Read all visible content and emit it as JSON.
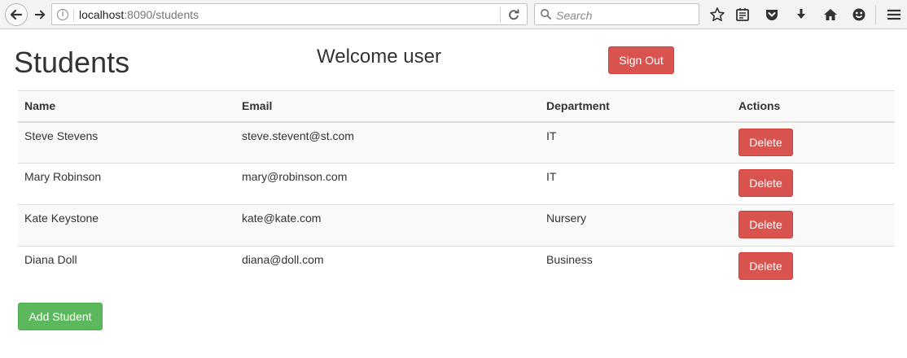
{
  "browser": {
    "url_host": "localhost",
    "url_rest": ":8090/students",
    "search_placeholder": "Search"
  },
  "header": {
    "title": "Students",
    "welcome": "Welcome user",
    "signout_label": "Sign Out"
  },
  "table": {
    "columns": [
      "Name",
      "Email",
      "Department",
      "Actions"
    ],
    "rows": [
      {
        "name": "Steve Stevens",
        "email": "steve.stevent@st.com",
        "department": "IT",
        "action": "Delete"
      },
      {
        "name": "Mary Robinson",
        "email": "mary@robinson.com",
        "department": "IT",
        "action": "Delete"
      },
      {
        "name": "Kate Keystone",
        "email": "kate@kate.com",
        "department": "Nursery",
        "action": "Delete"
      },
      {
        "name": "Diana Doll",
        "email": "diana@doll.com",
        "department": "Business",
        "action": "Delete"
      }
    ]
  },
  "footer": {
    "add_label": "Add Student"
  },
  "colors": {
    "danger": "#d9534f",
    "success": "#5cb85c",
    "stripe": "#f9f9f9"
  },
  "icons": [
    "back-arrow-icon",
    "forward-arrow-icon",
    "info-icon",
    "reload-icon",
    "search-icon",
    "bookmark-star-icon",
    "reader-list-icon",
    "pocket-icon",
    "download-icon",
    "home-icon",
    "smiley-icon",
    "hamburger-menu-icon"
  ]
}
